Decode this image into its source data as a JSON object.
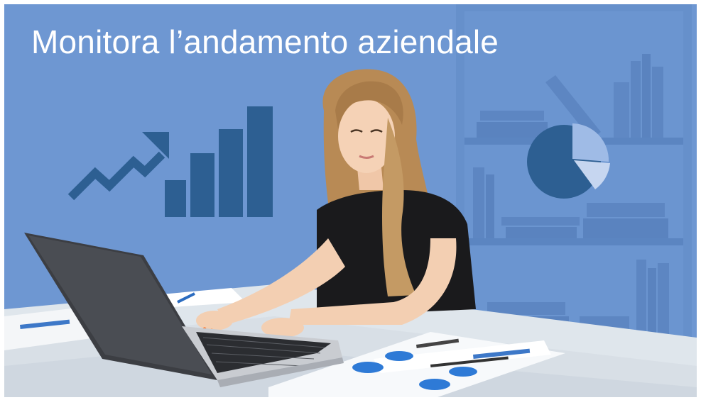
{
  "banner": {
    "title": "Monitora l’andamento aziendale"
  },
  "colors": {
    "background": "#6e97d2",
    "icon_dark": "#2d5f92",
    "shelf_tone": "#5d86c2",
    "pie_light": "#9fbbe6",
    "pie_lighter": "#c6d6f0"
  },
  "icons": [
    "trend-arrow-icon",
    "bar-chart-icon",
    "pie-chart-icon"
  ],
  "illustration": {
    "subject": "woman-working-at-laptop",
    "desk_items": [
      "laptop",
      "printed-report-charts",
      "pen"
    ]
  }
}
